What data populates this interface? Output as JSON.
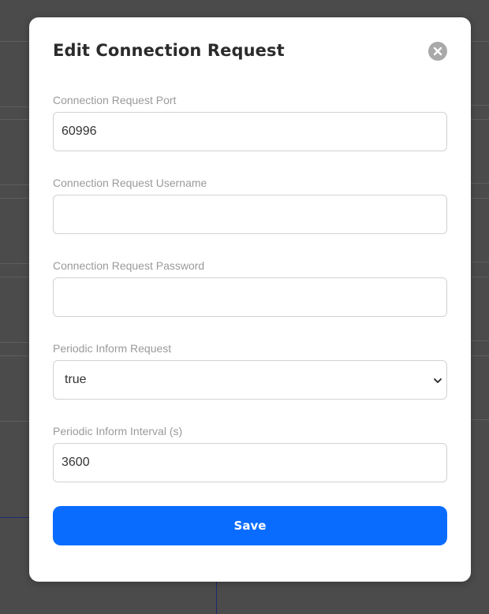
{
  "modal": {
    "title": "Edit Connection Request",
    "close_icon": "close-icon",
    "fields": [
      {
        "label": "Connection Request Port",
        "value": "60996"
      },
      {
        "label": "Connection Request Username",
        "value": ""
      },
      {
        "label": "Connection Request Password",
        "value": ""
      },
      {
        "label": "Periodic Inform Request",
        "value": "true",
        "type": "select"
      },
      {
        "label": "Periodic Inform Interval (s)",
        "value": "3600"
      }
    ],
    "save_label": "Save"
  },
  "colors": {
    "overlay": "#4b4b4b",
    "accent": "#0a6cff",
    "close_button": "#a9a9a9"
  }
}
